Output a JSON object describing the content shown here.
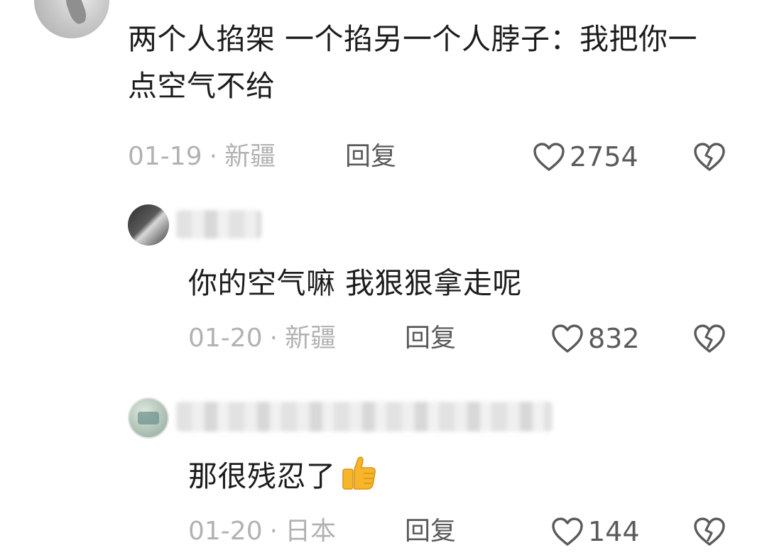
{
  "comments": [
    {
      "text": "两个人掐架 一个掐另一个人脖子：我把你一点空气不给",
      "date": "01-19",
      "location": "新疆",
      "reply_label": "回复",
      "likes": "2754"
    },
    {
      "text": "你的空气嘛 我狠狠拿走呢",
      "date": "01-20",
      "location": "新疆",
      "reply_label": "回复",
      "likes": "832"
    },
    {
      "text": "那很残忍了",
      "date": "01-20",
      "location": "日本",
      "reply_label": "回复",
      "likes": "144"
    }
  ],
  "separator": "·",
  "icons": {
    "like": "heart-outline-icon",
    "dislike": "broken-heart-icon",
    "emoji": "thumbs-up-emoji"
  },
  "colors": {
    "text": "#1c1c1c",
    "meta": "#b2b2b2",
    "action": "#5a5a5a",
    "background": "#ffffff"
  }
}
